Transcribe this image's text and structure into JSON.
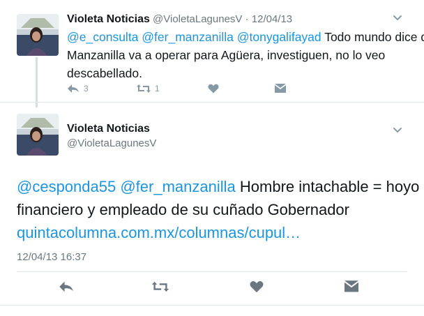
{
  "tweet1": {
    "display_name": "Violeta Noticias",
    "handle": "@VioletaLagunesV",
    "separator": "·",
    "date": "12/04/13",
    "mentions": [
      "@e_consulta",
      "@fer_manzanilla",
      "@tonygalifayad"
    ],
    "text": "Todo mundo dice que Manzanilla va a operar para Agüera, investiguen, no lo veo descabellado.",
    "actions": {
      "reply_count": "3",
      "retweet_count": "1"
    },
    "icons": [
      "chevron-down-icon",
      "reply-icon",
      "retweet-icon",
      "heart-icon",
      "direct-message-icon"
    ]
  },
  "tweet2": {
    "display_name": "Violeta Noticias",
    "handle": "@VioletaLagunesV",
    "mentions": [
      "@cesponda55",
      "@fer_manzanilla"
    ],
    "text": "Hombre intachable = hoyo financiero y empleado de su cuñado Gobernador",
    "link": "quintacolumna.com.mx/columnas/cupul…",
    "timestamp": "12/04/13 16:37",
    "icons": [
      "chevron-down-icon",
      "reply-icon",
      "retweet-icon",
      "heart-icon",
      "direct-message-icon"
    ]
  },
  "colors": {
    "link": "#1b95e0",
    "muted": "#6b7780",
    "icon": "#8899a6",
    "divider": "#e1e8ed"
  }
}
